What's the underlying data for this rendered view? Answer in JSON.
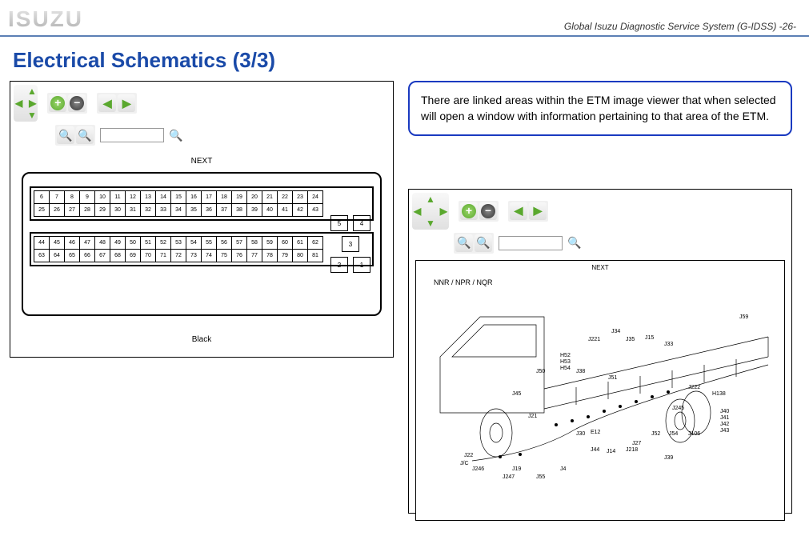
{
  "header": {
    "brand": "ISUZU",
    "right": "Global Isuzu Diagnostic Service System (G-IDSS) -26-"
  },
  "title": "Electrical Schematics (3/3)",
  "callout": "There are linked areas within the ETM image viewer that when selected will open a window with information pertaining to that area of the ETM.",
  "viewer_left": {
    "label_top": "NEXT",
    "label_bottom": "Black",
    "search_placeholder": "",
    "pins_row1": [
      "6",
      "7",
      "8",
      "9",
      "10",
      "11",
      "12",
      "13",
      "14",
      "15",
      "16",
      "17",
      "18",
      "19",
      "20",
      "21",
      "22",
      "23",
      "24"
    ],
    "pins_row2": [
      "25",
      "26",
      "27",
      "28",
      "29",
      "30",
      "31",
      "32",
      "33",
      "34",
      "35",
      "36",
      "37",
      "38",
      "39",
      "40",
      "41",
      "42",
      "43"
    ],
    "pins_row3": [
      "44",
      "45",
      "46",
      "47",
      "48",
      "49",
      "50",
      "51",
      "52",
      "53",
      "54",
      "55",
      "56",
      "57",
      "58",
      "59",
      "60",
      "61",
      "62"
    ],
    "pins_row4": [
      "63",
      "64",
      "65",
      "66",
      "67",
      "68",
      "69",
      "70",
      "71",
      "72",
      "73",
      "74",
      "75",
      "76",
      "77",
      "78",
      "79",
      "80",
      "81"
    ],
    "side_5": "5",
    "side_4": "4",
    "side_3": "3",
    "side_2": "2",
    "side_1": "1"
  },
  "viewer_right": {
    "label_top": "NEXT",
    "model": "NNR / NPR / NQR",
    "search_placeholder": "",
    "labels": {
      "j59": "J59",
      "j34": "J34",
      "j221": "J221",
      "j35": "J35",
      "j15": "J15",
      "j33": "J33",
      "h52": "H52",
      "h53": "H53",
      "h54": "H54",
      "j50": "J50",
      "j38": "J38",
      "j51": "J51",
      "j45": "J45",
      "j222": "J222",
      "h138": "H138",
      "j245": "J245",
      "j21": "J21",
      "j40": "J40",
      "j41": "J41",
      "j42": "J42",
      "j43": "J43",
      "j106": "J106",
      "j54": "J54",
      "j52": "J52",
      "j27": "J27",
      "j218": "J218",
      "j14": "J14",
      "j44": "J44",
      "j4": "J4",
      "j30": "J30",
      "e12": "E12",
      "j39": "J39",
      "j246": "J246",
      "j247": "J247",
      "j55": "J55",
      "j19": "J19",
      "j22": "J22",
      "jc": "J/C"
    }
  }
}
